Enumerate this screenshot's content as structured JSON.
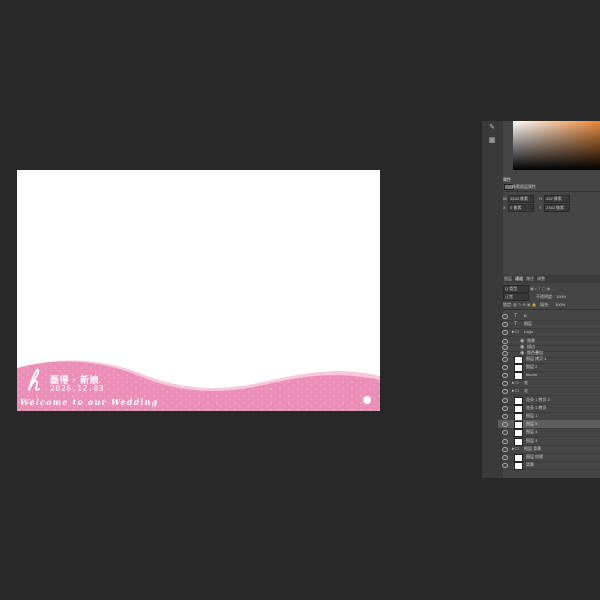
{
  "canvas": {
    "couple_names": "磊得 · 新娘",
    "date": "2026.12.03",
    "tagline": "Welcome to our Wedding",
    "colors": {
      "wave_pink": "#ec8fb8",
      "wave_light": "#f7c7dc",
      "page_bg": "#282828"
    }
  },
  "color_panel": {
    "gradient_from": "#ffffff",
    "gradient_to": "#e8893a"
  },
  "properties_panel": {
    "title": "属性",
    "doc_label": "像素图层属性",
    "w_label": "W",
    "w_value": "3543 像素",
    "h_label": "H",
    "h_value": "492 像素",
    "x_label": "X",
    "x_value": "0 像素",
    "y_label": "Y",
    "y_value": "2362 像素"
  },
  "layers_panel": {
    "tabs": [
      "图层",
      "通道",
      "路径",
      "调整"
    ],
    "filter_label": "Q 类型",
    "blend_mode": "正常",
    "opacity_label": "不透明度:",
    "opacity_value": "100%",
    "lock_label": "锁定:",
    "fill_label": "填充:",
    "fill_value": "100%",
    "layers": [
      {
        "name": "B",
        "kind": "text"
      },
      {
        "name": "图层",
        "kind": "text"
      },
      {
        "name": "Logo",
        "kind": "group"
      },
      {
        "name": "效果",
        "kind": "fx"
      },
      {
        "name": "描边",
        "kind": "fx"
      },
      {
        "name": "颜色叠加",
        "kind": "fx"
      },
      {
        "name": "图层 拷贝 1",
        "kind": "pixel"
      },
      {
        "name": "图层 2",
        "kind": "pixel"
      },
      {
        "name": "bloom",
        "kind": "pixel"
      },
      {
        "name": "花",
        "kind": "group"
      },
      {
        "name": "花",
        "kind": "group"
      },
      {
        "name": "花朵 1 拷贝 2",
        "kind": "pixel"
      },
      {
        "name": "花朵 1 拷贝",
        "kind": "pixel"
      },
      {
        "name": "图层 1",
        "kind": "pixel"
      },
      {
        "name": "图层 5",
        "kind": "pixel",
        "selected": true
      },
      {
        "name": "图层 4",
        "kind": "pixel"
      },
      {
        "name": "图层 3",
        "kind": "pixel"
      },
      {
        "name": "图层 背景",
        "kind": "group"
      },
      {
        "name": "图层 纹理",
        "kind": "pixel"
      },
      {
        "name": "背景",
        "kind": "pixel"
      }
    ]
  }
}
